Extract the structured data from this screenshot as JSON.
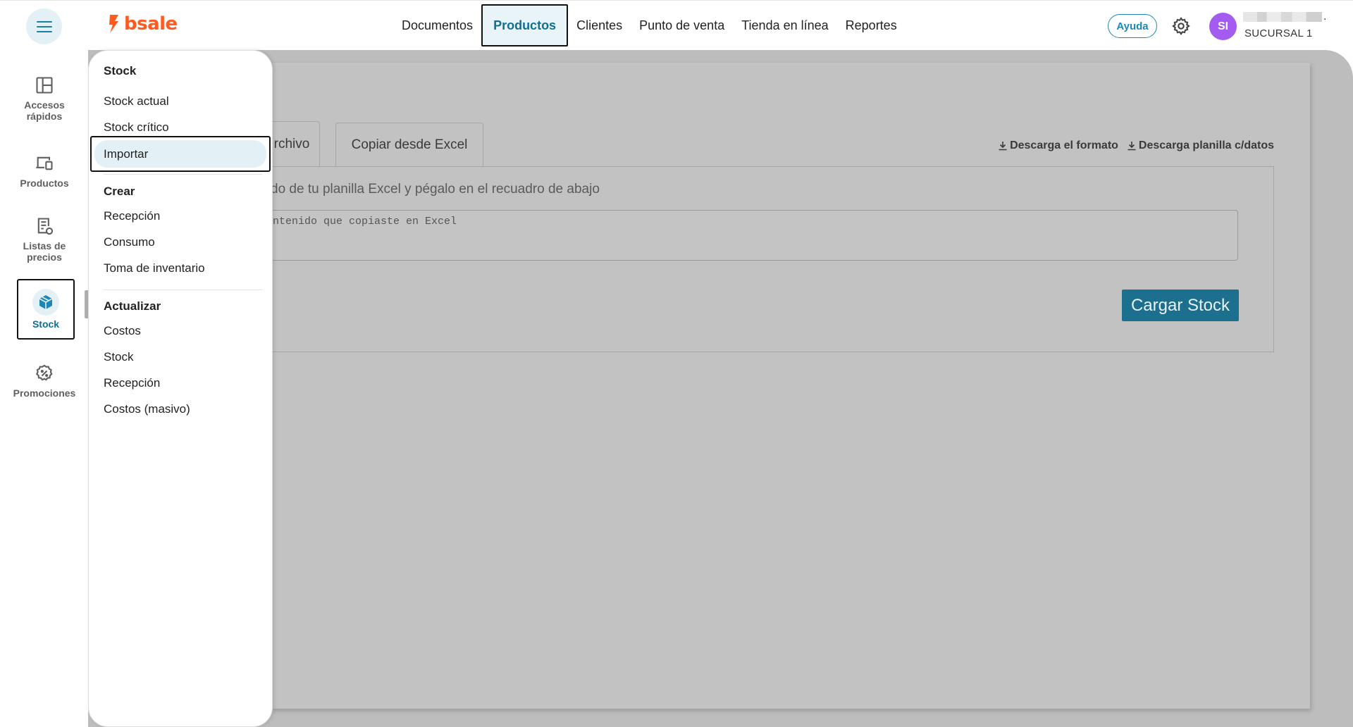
{
  "brand": {
    "name": "bsale",
    "color": "#ff5a1f"
  },
  "topnav": {
    "items": [
      {
        "label": "Documentos",
        "active": false
      },
      {
        "label": "Productos",
        "active": true
      },
      {
        "label": "Clientes",
        "active": false
      },
      {
        "label": "Punto de venta",
        "active": false
      },
      {
        "label": "Tienda en línea",
        "active": false
      },
      {
        "label": "Reportes",
        "active": false
      }
    ],
    "help_label": "Ayuda",
    "settings_icon": "gear-icon",
    "avatar_initials": "SI",
    "avatar_color": "#a35bf0",
    "branch": "SUCURSAL 1"
  },
  "sidebar": {
    "items": [
      {
        "label_line1": "Accesos",
        "label_line2": "rápidos",
        "icon": "quick-access-icon"
      },
      {
        "label_line1": "Productos",
        "label_line2": "",
        "icon": "devices-icon"
      },
      {
        "label_line1": "Listas de",
        "label_line2": "precios",
        "icon": "price-list-icon"
      },
      {
        "label_line1": "Stock",
        "label_line2": "",
        "icon": "box-icon",
        "active": true
      },
      {
        "label_line1": "Promociones",
        "label_line2": "",
        "icon": "promo-badge-icon"
      }
    ]
  },
  "submenu": {
    "sections": [
      {
        "heading": "Stock",
        "items": [
          "Stock actual",
          "Stock crítico",
          "Importar"
        ]
      },
      {
        "heading": "Crear",
        "items": [
          "Recepción",
          "Consumo",
          "Toma de inventario"
        ]
      },
      {
        "heading": "Actualizar",
        "items": [
          "Costos",
          "Stock",
          "Recepción",
          "Costos (masivo)"
        ]
      }
    ],
    "active_item": "Importar"
  },
  "page": {
    "tab_file_partial": "rchivo",
    "tab_excel": "Copiar desde Excel",
    "download_format": "Descarga el formato",
    "download_with_data": "Descarga planilla c/datos",
    "instruction_partial": "do de tu planilla Excel y pégalo en el recuadro de abajo",
    "textarea_placeholder_partial": "ntenido que copiaste en Excel",
    "load_button": "Cargar Stock"
  },
  "colors": {
    "accent": "#1e88b4",
    "active_bg": "#e3f1f6",
    "overlay": "#bdbdbd",
    "primary_button": "#1c6f8e"
  }
}
